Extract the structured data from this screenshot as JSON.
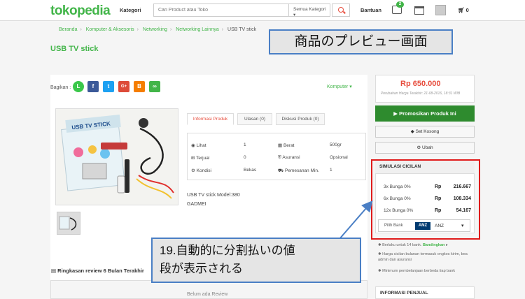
{
  "header": {
    "logo": "tokopedia",
    "kategori_label": "Kategori",
    "search_placeholder": "Cari Product atau Toko",
    "search_category": "Semua Kategori",
    "bantuan_label": "Bantuan",
    "mail_badge": "2",
    "cart_count": "0"
  },
  "breadcrumb": [
    "Beranda",
    "Komputer & Aksesoris",
    "Networking",
    "Networking Lainnya",
    "USB TV stick"
  ],
  "product": {
    "title": "USB TV stick",
    "share_label": "Bagikan :",
    "category_link": "Komputer",
    "image_text": "USB TV STICK",
    "description_lines": [
      "USB TV stick Model:380",
      "GADMEI"
    ]
  },
  "tabs": [
    {
      "label": "Informasi Produk"
    },
    {
      "label": "Ulasan (0)"
    },
    {
      "label": "Diskusi Produk (0)"
    }
  ],
  "info": {
    "rows": [
      {
        "l_label": "Lihat",
        "l_value": "1",
        "r_label": "Berat",
        "r_value": "500gr"
      },
      {
        "l_label": "Terjual",
        "l_value": "0",
        "r_label": "Asuransi",
        "r_value": "Opsional"
      },
      {
        "l_label": "Kondisi",
        "l_value": "Bekas",
        "r_label": "Pemesanan Min.",
        "r_value": "1"
      }
    ]
  },
  "review": {
    "title": "Ringkasan review 6 Bulan Terakhir",
    "empty": "Belum ada Review"
  },
  "sidebar": {
    "price": "Rp 650.000",
    "price_note": "Perubahan Harga Terakhir: 21-08-2016, 18:31 WIB",
    "promo_button": "Promosikan Produk Ini",
    "set_kosong": "Set Kosong",
    "ubah": "Ubah",
    "sim_title": "SIMULASI CICILAN",
    "installments": [
      {
        "term": "3x Bunga 0%",
        "cur": "Rp",
        "amount": "216.667"
      },
      {
        "term": "6x Bunga 0%",
        "cur": "Rp",
        "amount": "108.334"
      },
      {
        "term": "12x Bunga 0%",
        "cur": "Rp",
        "amount": "54.167"
      }
    ],
    "bank_label": "Pilih Bank",
    "bank_logo": "ANZ",
    "bank_value": "ANZ",
    "notes": [
      "Berlaku untuk 14 bank.",
      "Bandingkan",
      "Harga cicilan bulanan termasuk ongkos kirim, bea admin dan asuransi",
      "Minimum pembelanjaan berbeda tiap bank"
    ],
    "info_penjual": "INFORMASI PENJUAL"
  },
  "annotations": {
    "top": "商品のプレビュー画面",
    "line1": "19.自動的に分割払いの値",
    "line2": "段が表示される"
  },
  "colors": {
    "brand": "#42b549",
    "price": "#e74c3c",
    "promo": "#2e8b2e",
    "callout_border": "#4a7fc5",
    "highlight": "#e01b1b"
  }
}
